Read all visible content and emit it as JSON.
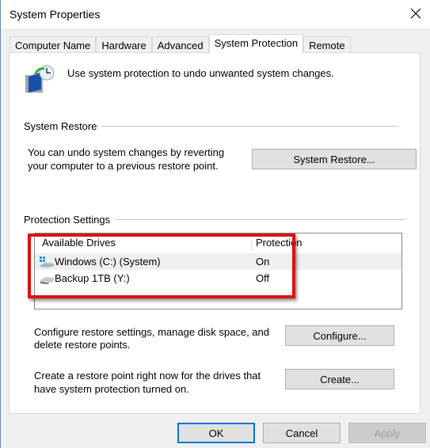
{
  "window": {
    "title": "System Properties",
    "close_icon": "close-icon"
  },
  "tabs": [
    {
      "label": "Computer Name"
    },
    {
      "label": "Hardware"
    },
    {
      "label": "Advanced"
    },
    {
      "label": "System Protection",
      "active": true
    },
    {
      "label": "Remote"
    }
  ],
  "intro": {
    "text": "Use system protection to undo unwanted system changes.",
    "icon": "system-protection-icon"
  },
  "system_restore": {
    "title": "System Restore",
    "description_line1": "You can undo system changes by reverting",
    "description_line2": "your computer to a previous restore point.",
    "button": "System Restore..."
  },
  "protection_settings": {
    "title": "Protection Settings",
    "columns": [
      "Available Drives",
      "Protection"
    ],
    "drives": [
      {
        "name": "Windows (C:) (System)",
        "protection": "On",
        "icon": "windows-drive-icon",
        "selected": true
      },
      {
        "name": "Backup 1TB (Y:)",
        "protection": "Off",
        "icon": "drive-icon"
      }
    ],
    "highlight_color": "#e01010",
    "configure_line1": "Configure restore settings, manage disk space, and",
    "configure_line2": "delete restore points.",
    "configure_button": "Configure...",
    "create_line1": "Create a restore point right now for the drives that",
    "create_line2": "have system protection turned on.",
    "create_button": "Create..."
  },
  "footer": {
    "ok": "OK",
    "cancel": "Cancel",
    "apply": "Apply",
    "apply_disabled": true
  }
}
